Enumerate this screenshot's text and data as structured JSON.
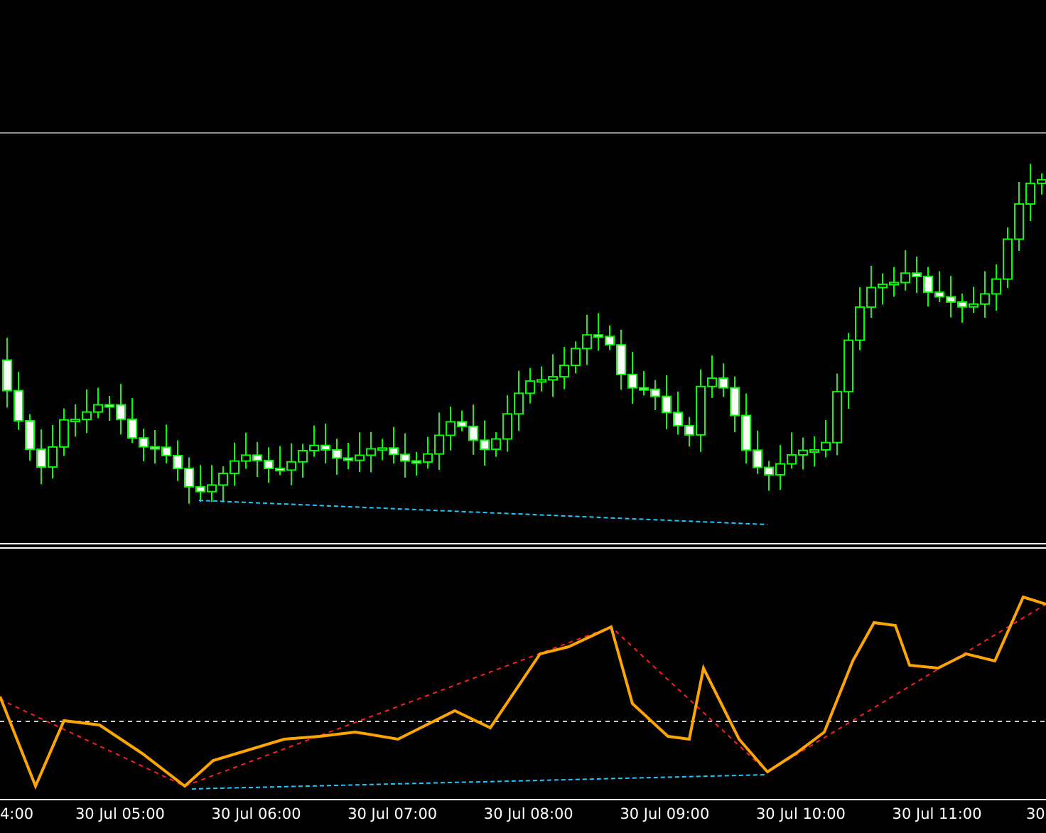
{
  "time_axis": {
    "labels": [
      "4:00",
      "30 Jul 05:00",
      "30 Jul 06:00",
      "30 Jul 07:00",
      "30 Jul 08:00",
      "30 Jul 09:00",
      "30 Jul 10:00",
      "30 Jul 11:00",
      "30"
    ]
  }
}
